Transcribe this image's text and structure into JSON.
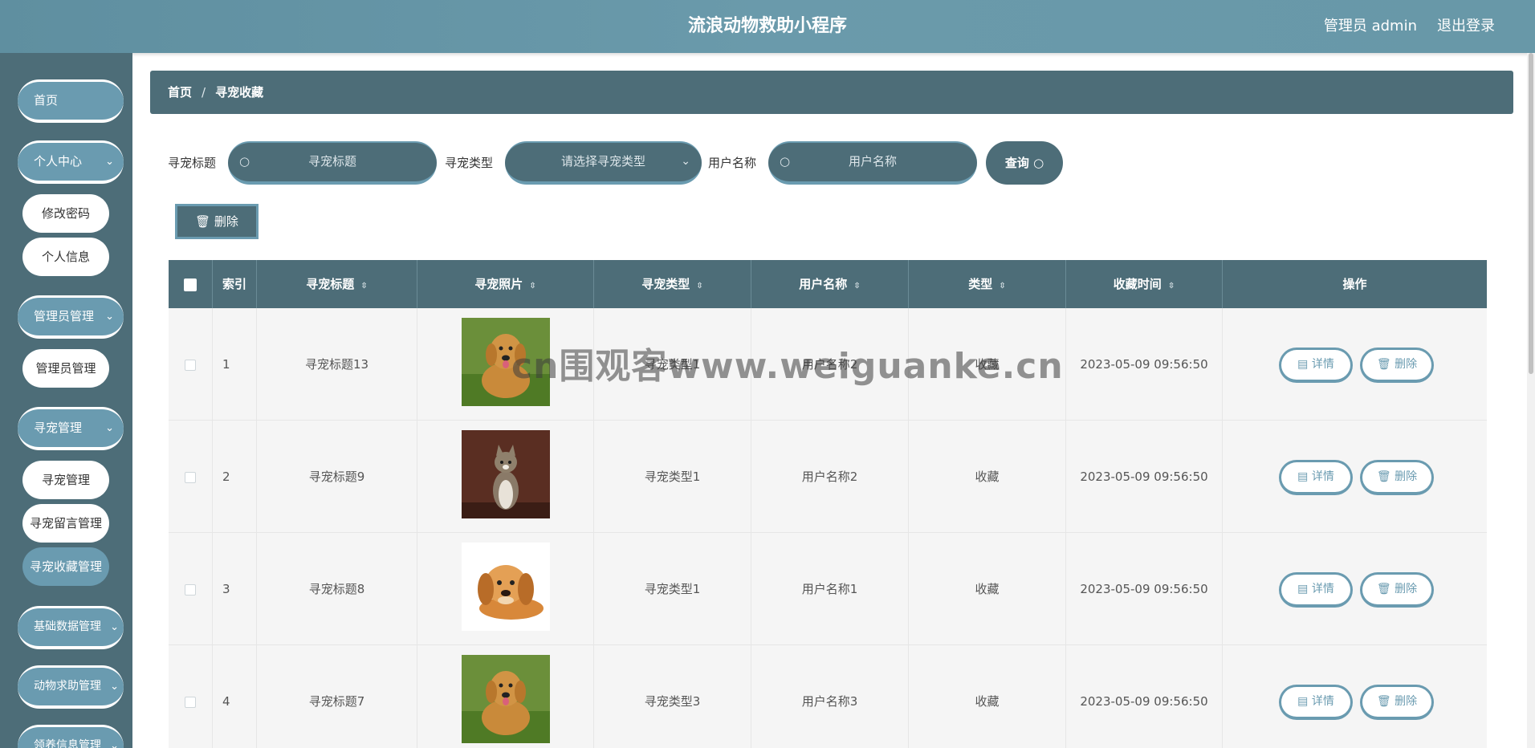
{
  "header": {
    "title": "流浪动物救助小程序",
    "user": "管理员 admin",
    "logout": "退出登录"
  },
  "sidebar": {
    "home": "首页",
    "personal": "个人中心",
    "change_password": "修改密码",
    "profile": "个人信息",
    "admin_mgmt": "管理员管理",
    "admin_mgmt_sub": "管理员管理",
    "pet_mgmt": "寻宠管理",
    "pet_sub": "寻宠管理",
    "pet_comment": "寻宠留言管理",
    "pet_fav": "寻宠收藏管理",
    "base_data": "基础数据管理",
    "rescue": "动物求助管理",
    "adopt": "领养信息管理",
    "chevron": "chevron-down"
  },
  "breadcrumb": {
    "home": "首页",
    "sep": "/",
    "current": "寻宠收藏"
  },
  "search": {
    "title_label": "寻宠标题",
    "title_placeholder": "寻宠标题",
    "type_label": "寻宠类型",
    "type_placeholder": "请选择寻宠类型",
    "user_label": "用户名称",
    "user_placeholder": "用户名称",
    "query": "查询"
  },
  "toolbar": {
    "delete": "删除"
  },
  "table": {
    "headers": [
      "索引",
      "寻宠标题",
      "寻宠照片",
      "寻宠类型",
      "用户名称",
      "类型",
      "收藏时间",
      "操作"
    ],
    "rows": [
      {
        "index": "1",
        "title": "寻宠标题13",
        "photo": "golden-dog",
        "type": "寻宠类型1",
        "user": "用户名称2",
        "kind": "收藏",
        "time": "2023-05-09 09:56:50"
      },
      {
        "index": "2",
        "title": "寻宠标题9",
        "photo": "tabby-cat",
        "type": "寻宠类型1",
        "user": "用户名称2",
        "kind": "收藏",
        "time": "2023-05-09 09:56:50"
      },
      {
        "index": "3",
        "title": "寻宠标题8",
        "photo": "puppy",
        "type": "寻宠类型1",
        "user": "用户名称1",
        "kind": "收藏",
        "time": "2023-05-09 09:56:50"
      },
      {
        "index": "4",
        "title": "寻宠标题7",
        "photo": "golden-dog",
        "type": "寻宠类型3",
        "user": "用户名称3",
        "kind": "收藏",
        "time": "2023-05-09 09:56:50"
      }
    ],
    "detail": "详情",
    "delete": "删除"
  },
  "watermark": "cn围观客www.weiguanke.cn",
  "colors": {
    "header": "#6a9aab",
    "sidebar": "#4d6d78",
    "accent": "#6a9bb0",
    "row": "#f5f5f5"
  }
}
